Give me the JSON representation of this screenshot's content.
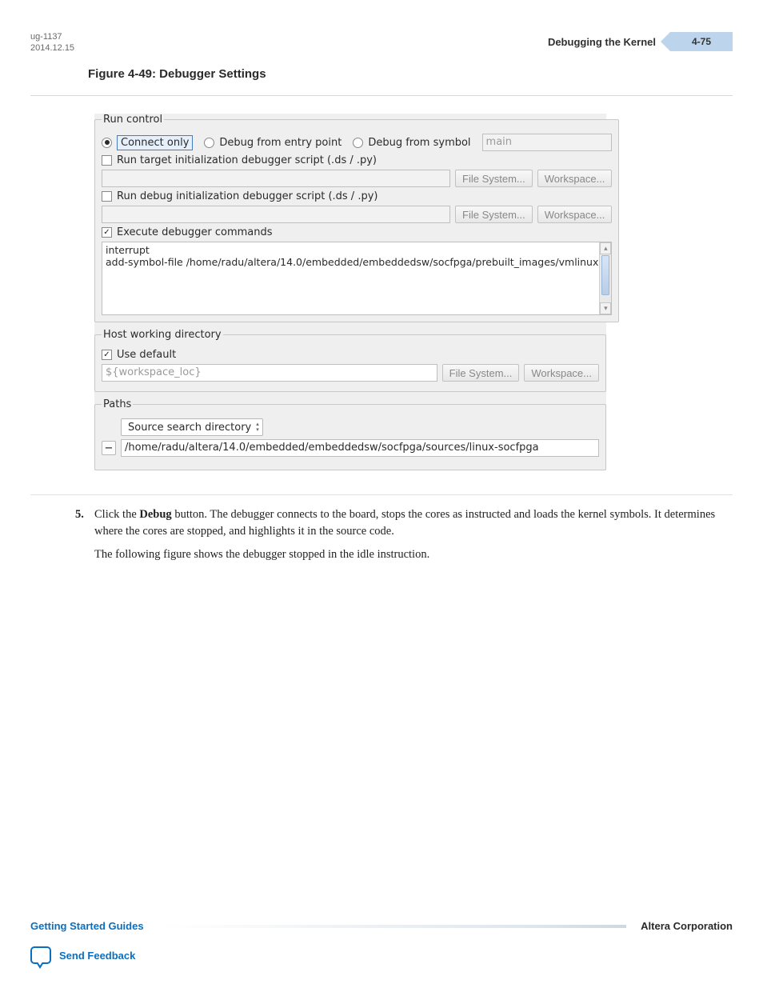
{
  "header": {
    "doc_code": "ug-1137",
    "date": "2014.12.15",
    "section_title": "Debugging the Kernel",
    "page_number": "4-75"
  },
  "figure_title": "Figure 4-49: Debugger Settings",
  "run_control": {
    "legend": "Run control",
    "radio_connect_only": "Connect only",
    "radio_debug_entry": "Debug from entry point",
    "radio_debug_symbol": "Debug from symbol",
    "symbol_placeholder": "main",
    "chk_target_init": "Run target initialization debugger script (.ds / .py)",
    "chk_debug_init": "Run debug initialization debugger script (.ds / .py)",
    "btn_filesystem": "File System...",
    "btn_workspace": "Workspace...",
    "chk_exec_cmds": "Execute debugger commands",
    "commands_text": "interrupt\nadd-symbol-file /home/radu/altera/14.0/embedded/embeddedsw/socfpga/prebuilt_images/vmlinux"
  },
  "host_dir": {
    "legend": "Host working directory",
    "chk_use_default": "Use default",
    "value": "${workspace_loc}",
    "btn_filesystem": "File System...",
    "btn_workspace": "Workspace..."
  },
  "paths": {
    "legend": "Paths",
    "combo_label": "Source search directory",
    "path_value": "/home/radu/altera/14.0/embedded/embeddedsw/socfpga/sources/linux-socfpga"
  },
  "step": {
    "number": "5.",
    "line1_a": "Click the ",
    "line1_bold": "Debug",
    "line1_b": " button. The debugger connects to the board, stops the cores as instructed and loads the kernel symbols. It determines where the cores are stopped, and highlights it in the source code.",
    "line2": "The following figure shows the debugger stopped in the idle instruction."
  },
  "footer": {
    "left_link": "Getting Started Guides",
    "right_text": "Altera Corporation",
    "feedback": "Send Feedback"
  }
}
